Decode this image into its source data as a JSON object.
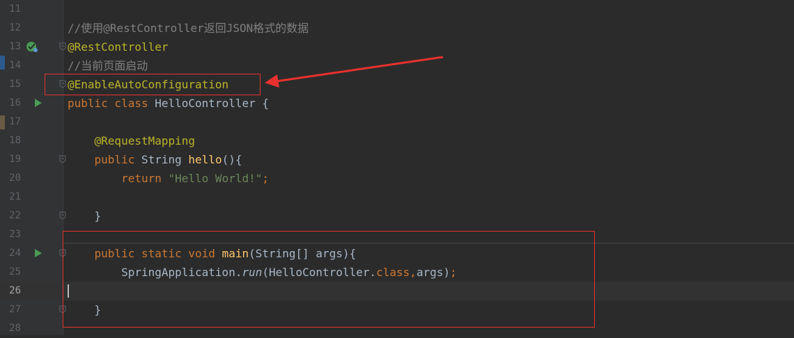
{
  "editor": {
    "lines": [
      {
        "number": "11",
        "tokens": []
      },
      {
        "number": "12",
        "tokens": [
          {
            "t": "//使用@RestController返回JSON格式的数据",
            "c": "comment"
          }
        ]
      },
      {
        "number": "13",
        "tokens": [
          {
            "t": "@RestController",
            "c": "annot"
          }
        ],
        "gutter_icon": "spring-bean-icon",
        "fold": true
      },
      {
        "number": "14",
        "tokens": [
          {
            "t": "//当前页面启动",
            "c": "comment"
          }
        ]
      },
      {
        "number": "15",
        "tokens": [
          {
            "t": "@EnableAutoConfiguration",
            "c": "annot"
          }
        ],
        "fold": true
      },
      {
        "number": "16",
        "tokens": [
          {
            "t": "public class ",
            "c": "kw"
          },
          {
            "t": "HelloController ",
            "c": "plain"
          },
          {
            "t": "{",
            "c": "plain"
          }
        ],
        "gutter_icon": "run-icon"
      },
      {
        "number": "17",
        "tokens": []
      },
      {
        "number": "18",
        "tokens": [
          {
            "t": "    @RequestMapping",
            "c": "annot"
          }
        ]
      },
      {
        "number": "19",
        "tokens": [
          {
            "t": "    public ",
            "c": "kw"
          },
          {
            "t": "String ",
            "c": "plain"
          },
          {
            "t": "hello",
            "c": "fn"
          },
          {
            "t": "(){",
            "c": "plain"
          }
        ],
        "fold": true
      },
      {
        "number": "20",
        "tokens": [
          {
            "t": "        return ",
            "c": "kw"
          },
          {
            "t": "\"Hello World!\"",
            "c": "str"
          },
          {
            "t": ";",
            "c": "punct"
          }
        ]
      },
      {
        "number": "21",
        "tokens": []
      },
      {
        "number": "22",
        "tokens": [
          {
            "t": "    }",
            "c": "plain"
          }
        ],
        "fold": true
      },
      {
        "number": "23",
        "tokens": []
      },
      {
        "number": "24",
        "tokens": [
          {
            "t": "    public static void ",
            "c": "kw"
          },
          {
            "t": "main",
            "c": "fn"
          },
          {
            "t": "(String[] args){",
            "c": "plain"
          }
        ],
        "gutter_icon": "run-icon",
        "fold": true
      },
      {
        "number": "25",
        "tokens": [
          {
            "t": "        SpringApplication.",
            "c": "plain"
          },
          {
            "t": "run",
            "c": "plain",
            "italic": true
          },
          {
            "t": "(HelloController.",
            "c": "plain"
          },
          {
            "t": "class",
            "c": "kw"
          },
          {
            "t": ",",
            "c": "punct"
          },
          {
            "t": "args)",
            "c": "plain"
          },
          {
            "t": ";",
            "c": "punct"
          }
        ]
      },
      {
        "number": "26",
        "tokens": [],
        "current": true
      },
      {
        "number": "27",
        "tokens": [
          {
            "t": "    }",
            "c": "plain"
          }
        ],
        "fold": true
      },
      {
        "number": "28",
        "tokens": []
      }
    ]
  },
  "colors": {
    "background": "#2b2b2b",
    "annotation": "#bbb529",
    "keyword": "#cc7832",
    "comment": "#808080",
    "string": "#6a8759",
    "function": "#ffc66d",
    "highlight_box": "#e8312f"
  }
}
